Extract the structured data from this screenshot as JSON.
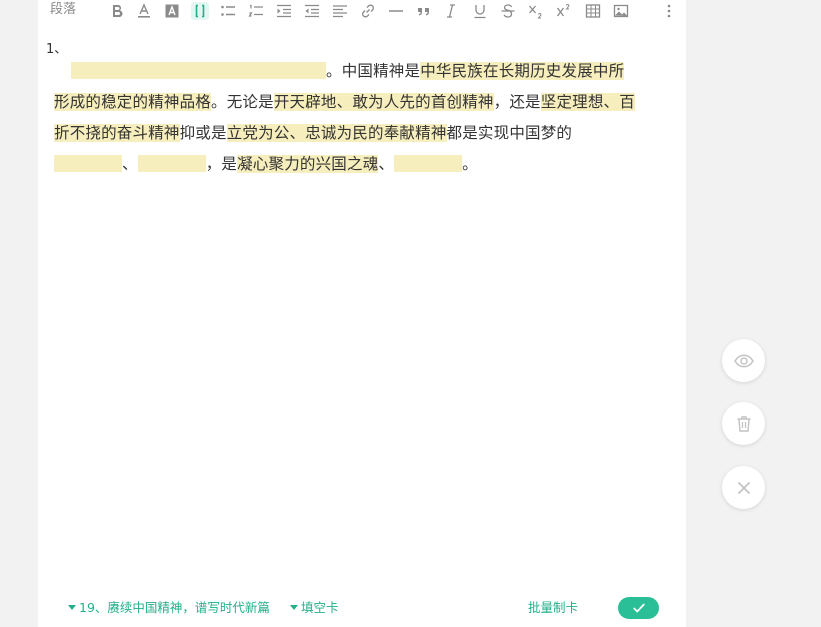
{
  "toolbar": {
    "paragraph_label": "段落",
    "buttons": [
      {
        "name": "bold-icon"
      },
      {
        "name": "font-color-icon"
      },
      {
        "name": "background-color-icon"
      },
      {
        "name": "cloze-icon",
        "active": true
      },
      {
        "name": "bullet-list-icon"
      },
      {
        "name": "ordered-list-icon"
      },
      {
        "name": "indent-icon"
      },
      {
        "name": "outdent-icon"
      },
      {
        "name": "align-icon"
      },
      {
        "name": "link-icon"
      },
      {
        "name": "horizontal-rule-icon"
      },
      {
        "name": "quote-icon"
      },
      {
        "name": "italic-icon"
      },
      {
        "name": "underline-icon"
      },
      {
        "name": "strikethrough-icon"
      },
      {
        "name": "subscript-icon"
      },
      {
        "name": "superscript-icon"
      },
      {
        "name": "table-icon"
      },
      {
        "name": "image-icon"
      },
      {
        "name": "more-icon"
      }
    ]
  },
  "content": {
    "item_number": "1、",
    "t1": "。中国精神是",
    "h1": "中华民族在长期历史发展中所形成的稳定的精神品格",
    "t2": "。无论是",
    "h2": "开天辟地、敢为人先的首创精神",
    "t3": "，还是",
    "h3": "坚定理想、百折不挠的奋斗精神",
    "t4": "抑或是",
    "h4": "立党为公、忠诚为民的奉献精神",
    "t5": "都是实现中国梦的",
    "t6": "、",
    "t7": "，是",
    "h5": "凝心聚力的兴国之魂",
    "t8": "、",
    "t9": "。"
  },
  "footer": {
    "deck": "19、赓续中国精神，谱写时代新篇",
    "card_type": "填空卡",
    "batch": "批量制卡"
  },
  "colors": {
    "accent": "#2bbf97",
    "highlight": "#f7eebd"
  }
}
